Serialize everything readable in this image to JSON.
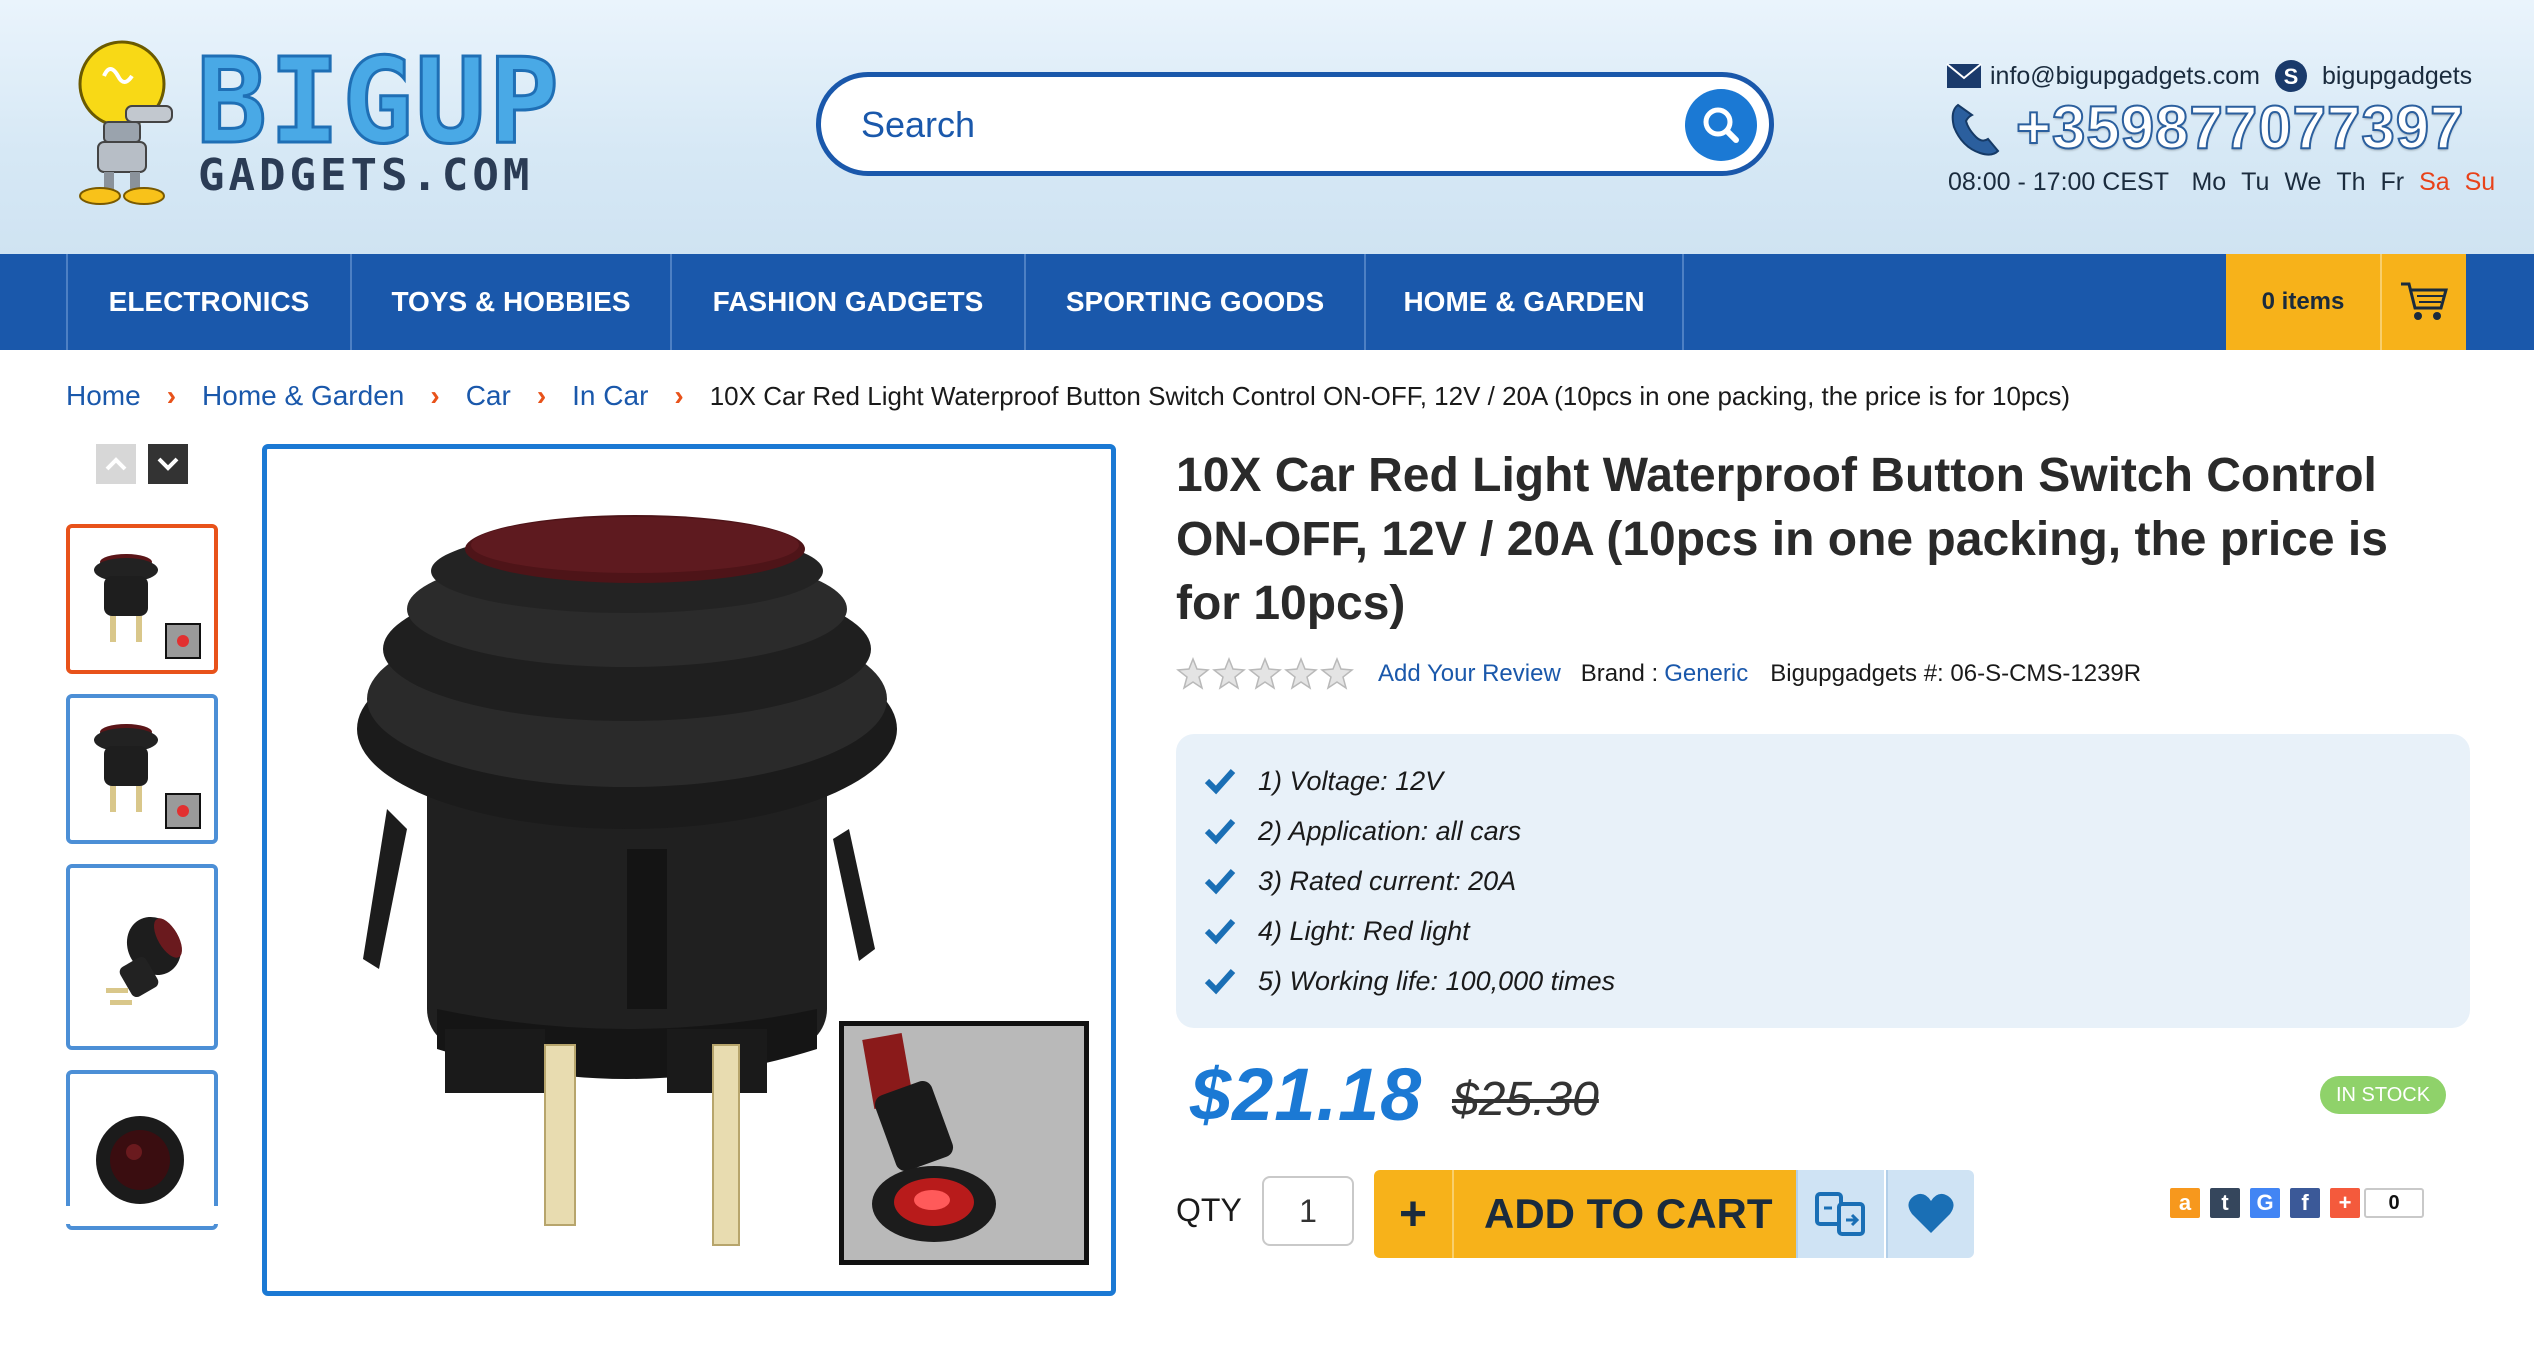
{
  "header": {
    "logo": {
      "word1": "BIGUP",
      "word2": "GADGETS.COM"
    },
    "search": {
      "placeholder": "Search"
    },
    "contact": {
      "email": "info@bigupgadgets.com",
      "skype": "bigupgadgets",
      "phone": "+359877077397",
      "hours": "08:00 - 17:00 CEST",
      "days": [
        "Mo",
        "Tu",
        "We",
        "Th",
        "Fr",
        "Sa",
        "Su"
      ]
    }
  },
  "nav": {
    "items": [
      {
        "label": "ELECTRONICS"
      },
      {
        "label": "TOYS & HOBBIES"
      },
      {
        "label": "FASHION GADGETS"
      },
      {
        "label": "SPORTING GOODS"
      },
      {
        "label": "HOME & GARDEN"
      }
    ],
    "cart": {
      "label": "0 items"
    }
  },
  "breadcrumb": {
    "links": [
      "Home",
      "Home & Garden",
      "Car",
      "In Car"
    ],
    "separator": "›",
    "current": "10X Car Red Light Waterproof Button Switch Control ON-OFF, 12V / 20A (10pcs in one packing, the price is for 10pcs)"
  },
  "product": {
    "title": "10X Car Red Light Waterproof Button Switch Control ON-OFF, 12V / 20A (10pcs in one packing, the price is for 10pcs)",
    "rating": 0,
    "review_link": "Add Your Review",
    "brand_label": "Brand :",
    "brand": "Generic",
    "sku": "Bigupgadgets #: 06-S-CMS-1239R",
    "specs": [
      "1) Voltage: 12V",
      "2) Application: all cars",
      "3) Rated current: 20A",
      "4) Light: Red light",
      "5) Working life: 100,000 times"
    ],
    "price": "$21.18",
    "old_price": "$25.30",
    "stock": "IN STOCK",
    "qty_label": "QTY",
    "qty": "1",
    "add_plus": "+",
    "add_to_cart": "ADD TO CART",
    "share_count": "0"
  },
  "colors": {
    "primary": "#1a58ab",
    "accent_orange": "#f7b21a",
    "price_blue": "#1b79d4",
    "breadcrumb_sep": "#e8521a",
    "stock_green": "#8fd26a"
  }
}
